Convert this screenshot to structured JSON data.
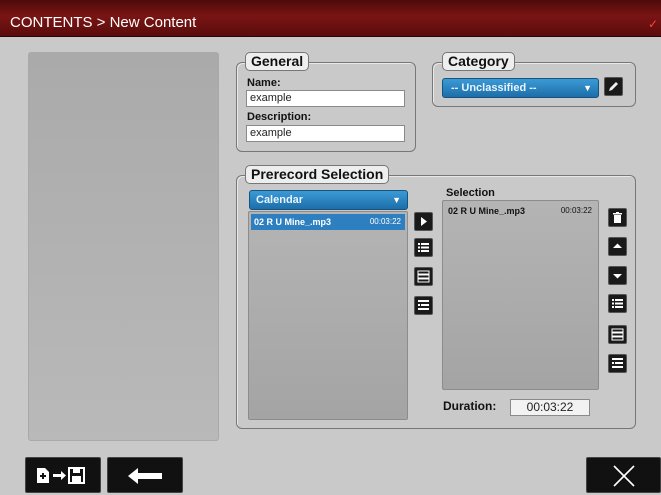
{
  "window": {
    "title": "CONTENTS > New Content"
  },
  "general": {
    "legend": "General",
    "name_label": "Name:",
    "name_value": "example",
    "description_label": "Description:",
    "description_value": "example"
  },
  "category": {
    "legend": "Category",
    "selected": "-- Unclassified --"
  },
  "prerecord": {
    "legend": "Prerecord Selection",
    "source_selected": "Calendar",
    "available": [
      {
        "title": "02 R U Mine_.mp3",
        "duration": "00:03:22"
      }
    ],
    "selection_label": "Selection",
    "selection": [
      {
        "title": "02 R U Mine_.mp3",
        "duration": "00:03:22"
      }
    ],
    "duration_label": "Duration:",
    "duration_value": "00:03:22"
  },
  "icons": {
    "add": "play-right-icon",
    "list_all": "list-icon",
    "list_variant": "list-detail-icon",
    "list_filter": "list-sort-icon",
    "delete": "trash-icon",
    "up": "arrow-up-icon",
    "down": "arrow-down-icon",
    "save": "save-icon",
    "back": "back-arrow-icon",
    "close": "close-icon"
  },
  "colors": {
    "titlebar": "#6a1010",
    "accent": "#2d7fbf",
    "panel": "#c9c9c9"
  }
}
